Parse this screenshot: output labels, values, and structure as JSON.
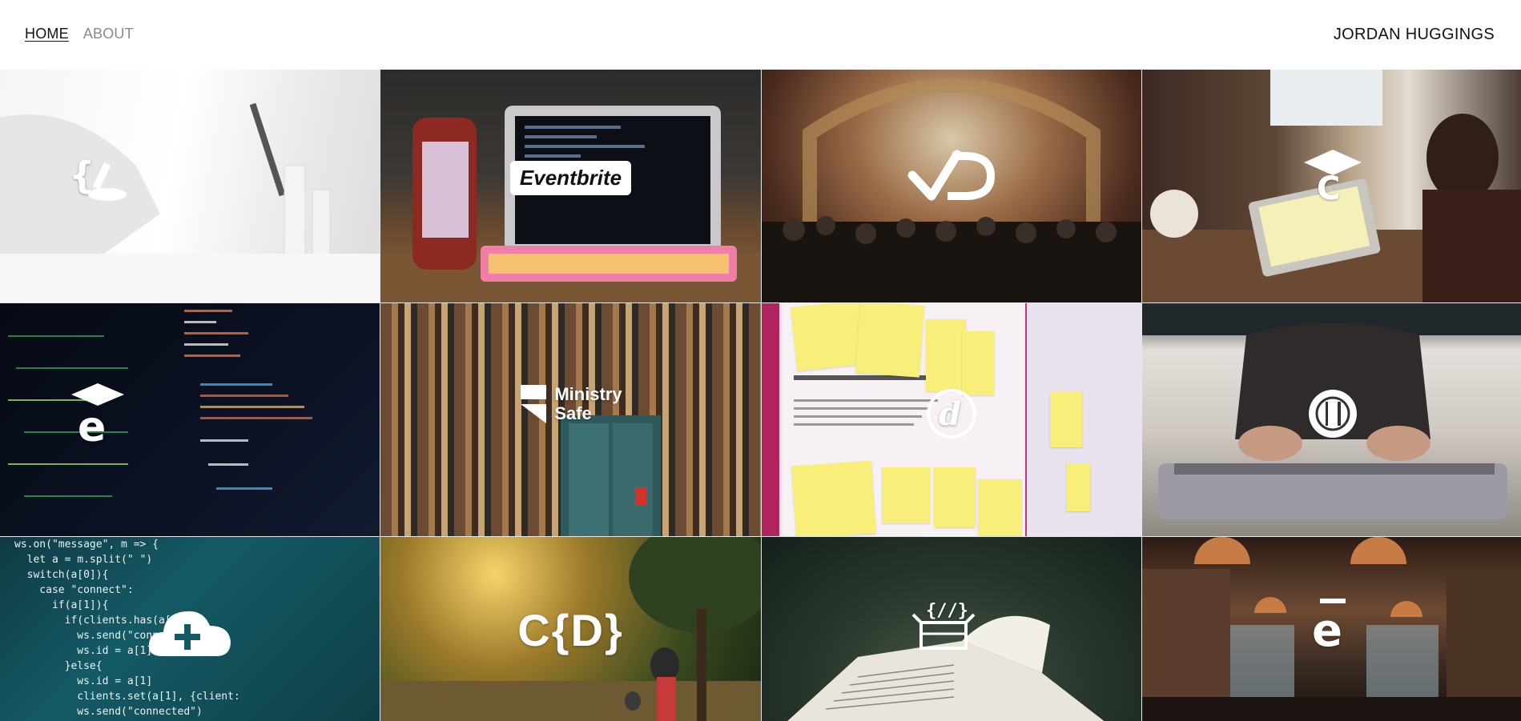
{
  "header": {
    "nav": [
      {
        "label": "HOME",
        "active": true
      },
      {
        "label": "ABOUT",
        "active": false
      }
    ],
    "brand": "JORDAN HUGGINGS"
  },
  "tiles": [
    {
      "icon": "code-brackets-icon",
      "logo_text": ""
    },
    {
      "icon": "eventbrite-logo",
      "logo_text": "Eventbrite"
    },
    {
      "icon": "checkmark-d-logo-icon",
      "logo_text": ""
    },
    {
      "icon": "graduation-cap-c-icon",
      "logo_text": ""
    },
    {
      "icon": "graduation-cap-e-icon",
      "logo_text": ""
    },
    {
      "icon": "ministry-safe-logo",
      "logo_text": "Ministry\nSafe"
    },
    {
      "icon": "d-circle-logo-icon",
      "logo_text": ""
    },
    {
      "icon": "fork-knife-circle-icon",
      "logo_text": ""
    },
    {
      "icon": "cloud-plus-icon",
      "logo_text": ""
    },
    {
      "icon": "code-d-logo",
      "logo_text": "C{D}"
    },
    {
      "icon": "box-code-icon",
      "logo_text": ""
    },
    {
      "icon": "e-logo-icon",
      "logo_text": ""
    }
  ],
  "code_snippet": "ws.on(\"message\", m => {\n  let a = m.split(\" \")\n  switch(a[0]){\n    case \"connect\":\n      if(a[1]){\n        if(clients.has(a[\n          ws.send(\"conne\n          ws.id = a[1]\n        }else{\n          ws.id = a[1]\n          clients.set(a[1], {client:\n          ws.send(\"connected\")",
  "colors": {
    "nav_active": "#111111",
    "nav_inactive": "#8a8a8a",
    "background": "#ffffff"
  }
}
